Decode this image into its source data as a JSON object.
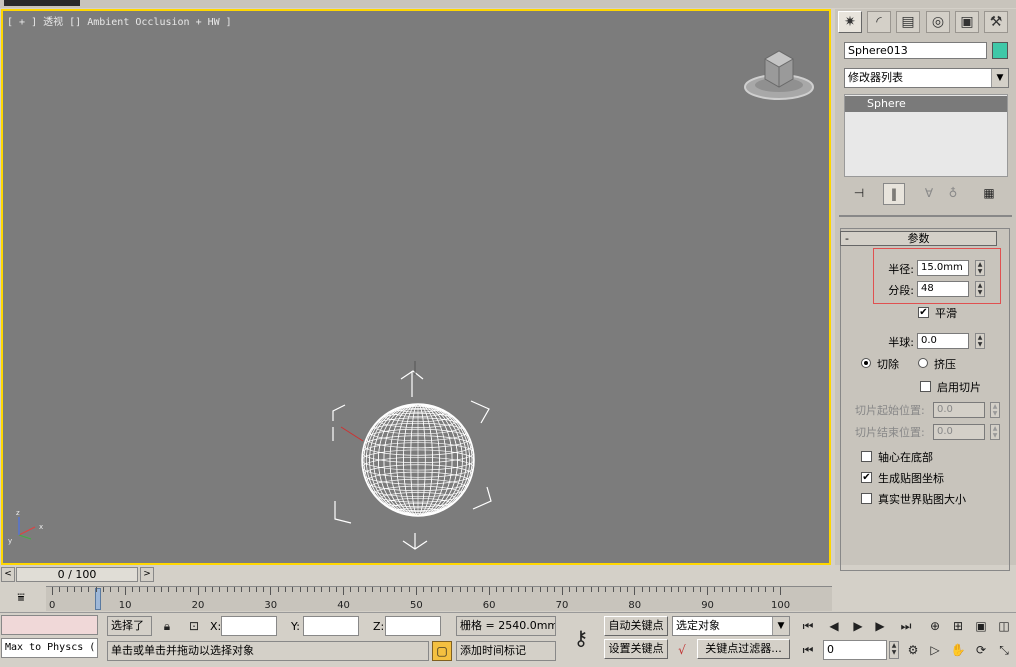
{
  "viewport": {
    "label": "[ + ] 透视 [] Ambient Occlusion + HW ]"
  },
  "command_panel": {
    "tabs": [
      "create-icon",
      "modify-icon",
      "hierarchy-icon",
      "motion-icon",
      "display-icon",
      "utilities-icon"
    ],
    "object_name": "Sphere013",
    "object_color": "#3fc8a8",
    "modifier_list": "修改器列表",
    "stack_item": "Sphere",
    "rollout_title": "参数",
    "rollout_toggle": "-",
    "radius_label": "半径:",
    "radius_value": "15.0mm",
    "segments_label": "分段:",
    "segments_value": "48",
    "smooth_label": "平滑",
    "smooth_checked": "✔",
    "hemisphere_label": "半球:",
    "hemisphere_value": "0.0",
    "chop_label": "切除",
    "squash_label": "挤压",
    "slice_on_label": "启用切片",
    "slice_from_label": "切片起始位置:",
    "slice_from_value": "0.0",
    "slice_to_label": "切片结束位置:",
    "slice_to_value": "0.0",
    "base_to_pivot_label": "轴心在底部",
    "gen_mapping_label": "生成贴图坐标",
    "gen_mapping_checked": "✔",
    "real_world_label": "真实世界贴图大小"
  },
  "timeline": {
    "frame": "0 / 100",
    "ticks": [
      "0",
      "10",
      "20",
      "30",
      "40",
      "50",
      "60",
      "70",
      "80",
      "90",
      "100"
    ]
  },
  "status": {
    "maxscript": "Max to Physcs (",
    "selection": "选择了",
    "x_label": "X:",
    "y_label": "Y:",
    "z_label": "Z:",
    "x_value": "",
    "y_value": "",
    "z_value": "",
    "grid": "栅格 = 2540.0mm",
    "prompt": "单击或单击并拖动以选择对象",
    "add_time_tag": "添加时间标记",
    "auto_key": "自动关键点",
    "set_key": "设置关键点",
    "selected_object": "选定对象",
    "key_filters": "关键点过滤器...",
    "current_frame": "0"
  }
}
